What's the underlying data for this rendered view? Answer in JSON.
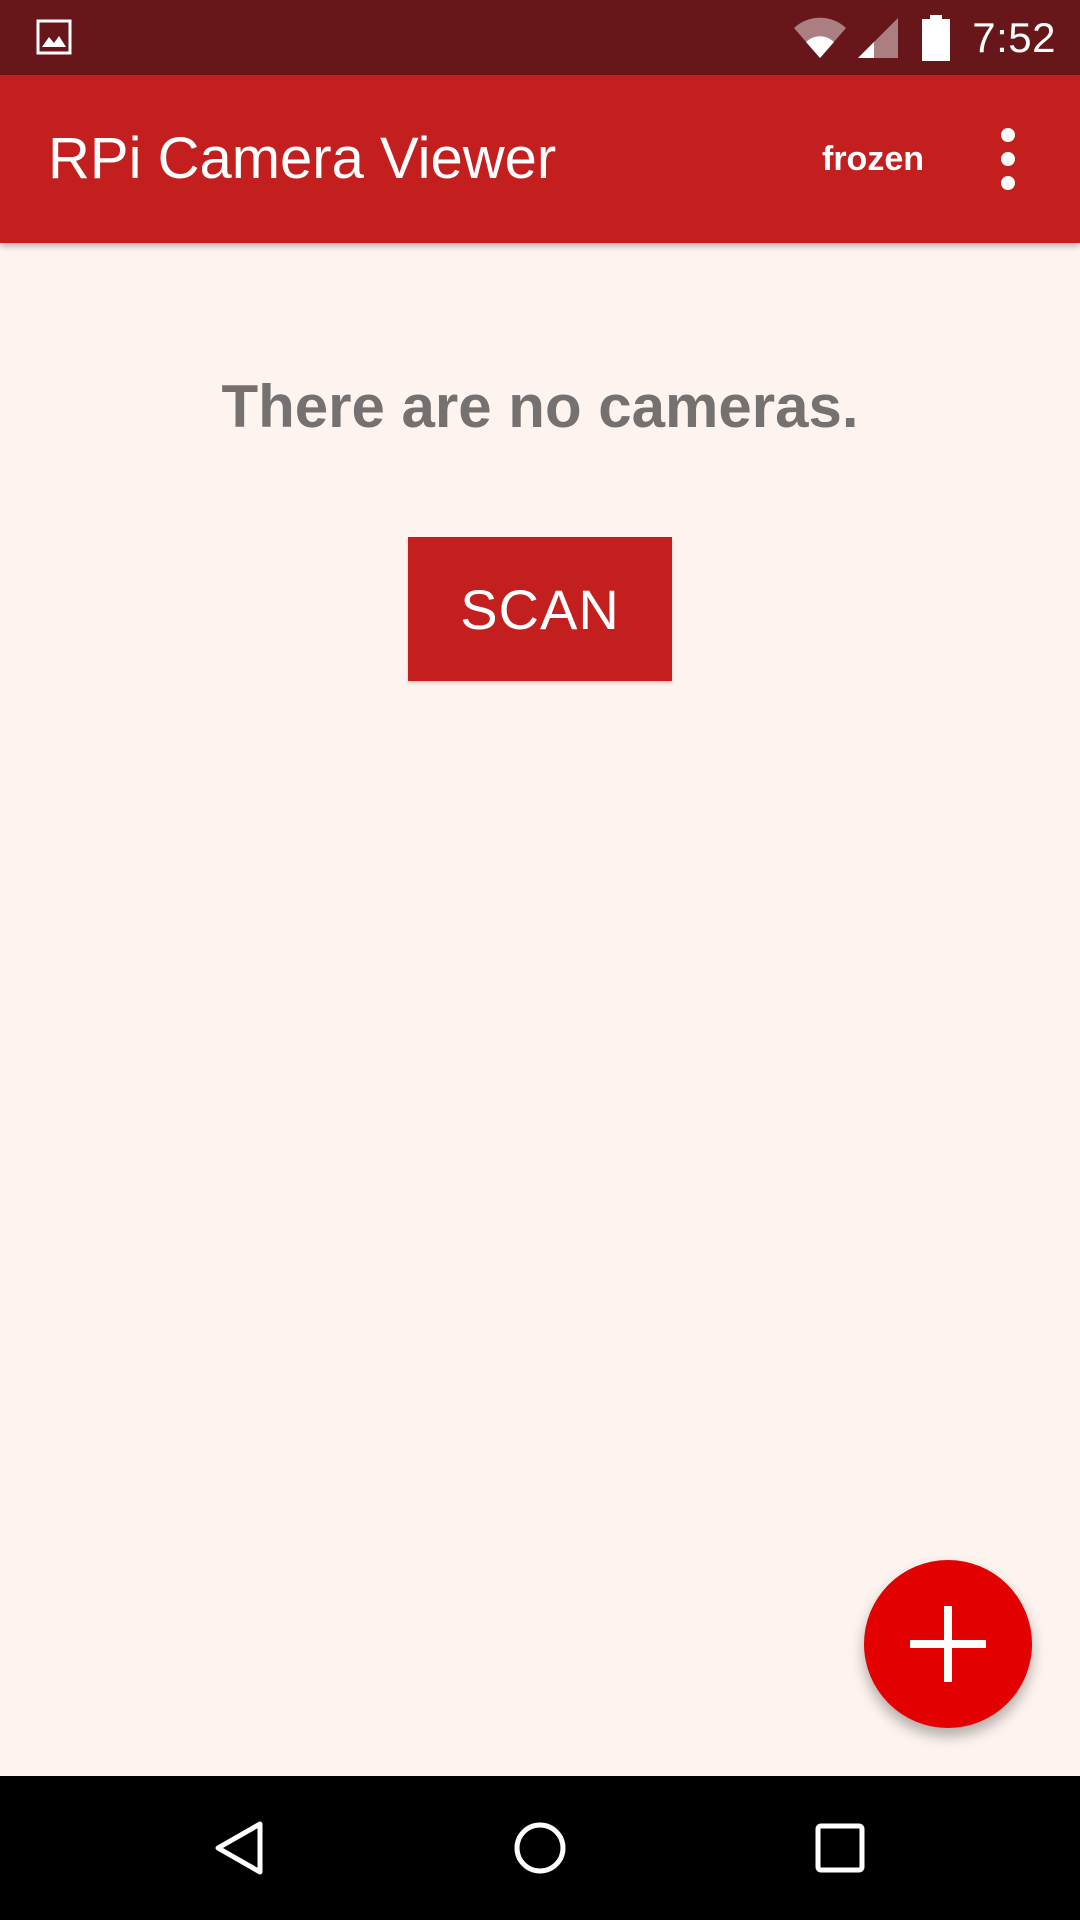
{
  "status_bar": {
    "time": "7:52",
    "left_icon": "image-notification-icon",
    "wifi_icon": "wifi-icon",
    "signal_icon": "cell-signal-icon",
    "battery_icon": "battery-icon",
    "background_color": "#67171a"
  },
  "app_bar": {
    "title": "RPi Camera Viewer",
    "action_label": "frozen",
    "overflow_icon": "more-vert-icon",
    "background_color": "#c41f1f"
  },
  "main": {
    "empty_message": "There are no cameras.",
    "scan_button_label": "SCAN",
    "background_color": "#fdf3ef"
  },
  "fab": {
    "icon": "plus-icon",
    "color": "#e20000"
  },
  "nav_bar": {
    "back_icon": "back-icon",
    "home_icon": "home-icon",
    "recents_icon": "recents-icon"
  }
}
